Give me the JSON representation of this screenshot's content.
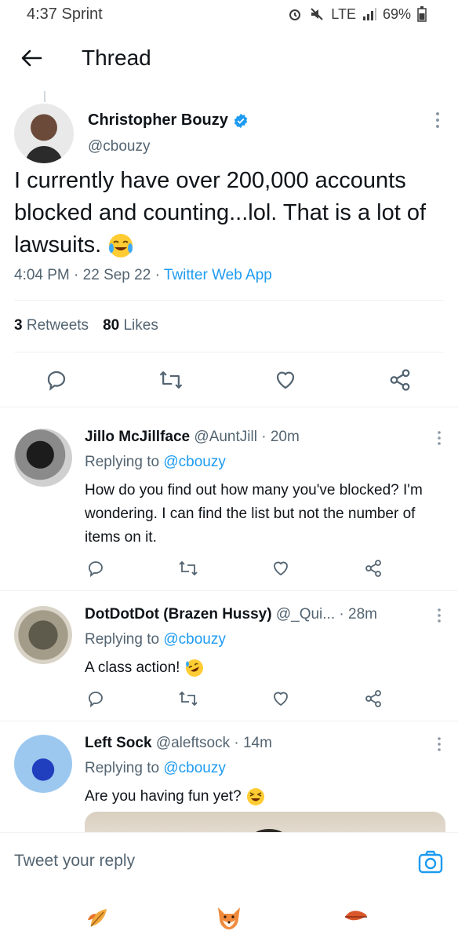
{
  "status_bar": {
    "time_carrier": "4:37 Sprint",
    "network": "LTE",
    "battery": "69%"
  },
  "header": {
    "title": "Thread"
  },
  "main_tweet": {
    "author_name": "Christopher Bouzy",
    "handle": "@cbouzy",
    "text": "I currently have over 200,000 accounts blocked and counting...lol. That is a lot of lawsuits.",
    "time": "4:04 PM",
    "date": "22 Sep 22",
    "source": "Twitter Web App",
    "retweets_count": "3",
    "retweets_label": "Retweets",
    "likes_count": "80",
    "likes_label": "Likes"
  },
  "replies": [
    {
      "name": "Jillo McJillface",
      "handle": "@AuntJill",
      "time": "20m",
      "replying_label": "Replying to",
      "replying_to": "@cbouzy",
      "text": "How do you find out how many you've blocked? I'm wondering. I can find the list but not the number of items on it."
    },
    {
      "name": "DotDotDot (Brazen Hussy)",
      "handle": "@_Qui...",
      "time": "28m",
      "replying_label": "Replying to",
      "replying_to": "@cbouzy",
      "text": "A class action!"
    },
    {
      "name": "Left Sock",
      "handle": "@aleftsock",
      "time": "14m",
      "replying_label": "Replying to",
      "replying_to": "@cbouzy",
      "text": "Are you having fun yet?"
    }
  ],
  "composer": {
    "placeholder": "Tweet your reply"
  },
  "colors": {
    "accent": "#1d9bf0",
    "secondary_text": "#536471",
    "primary_text": "#0f1419",
    "divider": "#eff3f4"
  },
  "icons": [
    "back-arrow-icon",
    "verified-badge-icon",
    "more-vertical-icon",
    "reply-icon",
    "retweet-icon",
    "like-icon",
    "share-icon",
    "camera-icon",
    "leaf-icon",
    "fox-icon"
  ]
}
